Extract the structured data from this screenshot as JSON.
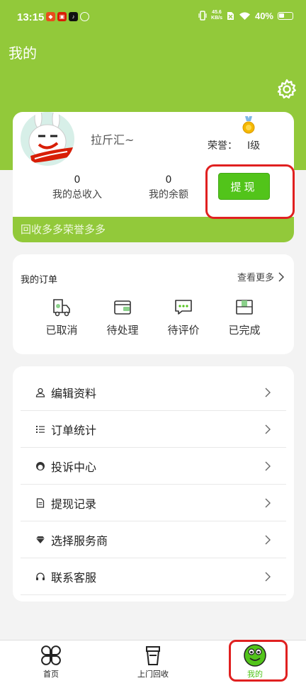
{
  "status_bar": {
    "time": "13:15",
    "speed_top": "45.6",
    "speed_bottom": "KB/s",
    "battery": "40%"
  },
  "header": {
    "title": "我的"
  },
  "profile": {
    "nickname": "拉斤汇~",
    "honor_label": "荣誉：",
    "honor_level": "Ⅰ级",
    "stats": [
      {
        "value": "0",
        "label": "我的总收入"
      },
      {
        "value": "0",
        "label": "我的余额"
      }
    ],
    "withdraw_label": "提现",
    "slogan": "回收多多荣誉多多"
  },
  "orders": {
    "title": "我的订单",
    "more_label": "查看更多",
    "items": [
      {
        "label": "已取消",
        "icon": "cancelled-order-icon"
      },
      {
        "label": "待处理",
        "icon": "pending-order-icon"
      },
      {
        "label": "待评价",
        "icon": "to-review-icon"
      },
      {
        "label": "已完成",
        "icon": "completed-order-icon"
      }
    ]
  },
  "menu": {
    "items": [
      {
        "label": "编辑资料",
        "icon": "user-icon"
      },
      {
        "label": "订单统计",
        "icon": "list-icon"
      },
      {
        "label": "投诉中心",
        "icon": "complaint-icon"
      },
      {
        "label": "提现记录",
        "icon": "document-icon"
      },
      {
        "label": "选择服务商",
        "icon": "diamond-icon"
      },
      {
        "label": "联系客服",
        "icon": "headset-icon"
      }
    ]
  },
  "tabbar": {
    "items": [
      {
        "label": "首页",
        "icon": "clover-icon"
      },
      {
        "label": "上门回收",
        "icon": "recycle-bin-icon"
      },
      {
        "label": "我的",
        "icon": "frog-face-icon"
      }
    ]
  },
  "colors": {
    "brand_green": "#92c93a",
    "button_green": "#52c41a",
    "highlight_red": "#e02020"
  }
}
